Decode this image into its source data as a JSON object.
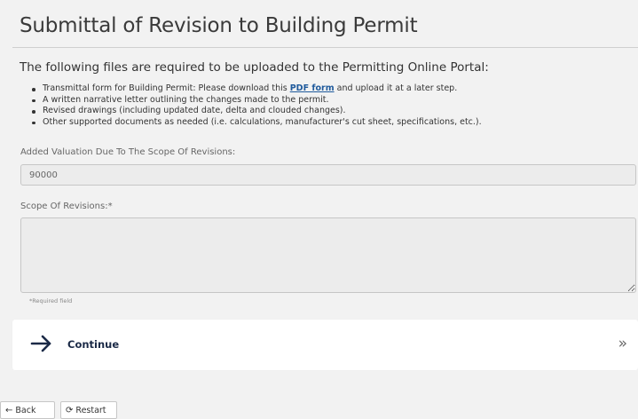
{
  "page": {
    "title": "Submittal of Revision to Building Permit",
    "intro_heading": "The following files are required to be uploaded to the Permitting Online Portal:"
  },
  "requirements": {
    "item1_prefix": "Transmittal form for Building Permit: Please download this ",
    "item1_link": "PDF form",
    "item1_suffix": " and upload it at a later step.",
    "item2": "A written narrative letter outlining the changes made to the permit.",
    "item3": "Revised drawings (including updated date, delta and clouded changes).",
    "item4": "Other supported documents as needed (i.e. calculations, manufacturer's cut sheet, specifications, etc.)."
  },
  "fields": {
    "valuation_label": "Added Valuation Due To The Scope Of Revisions:",
    "valuation_value": "90000",
    "scope_label": "Scope Of Revisions:*",
    "scope_value": "",
    "required_note": "*Required field"
  },
  "continue": {
    "label": "Continue",
    "arrow_icon": "arrow-right-icon",
    "chevrons": "»"
  },
  "footer": {
    "back_label": "Back",
    "back_icon": "←",
    "restart_label": "Restart",
    "restart_icon": "⟳"
  },
  "colors": {
    "link": "#1f5a9c",
    "continue_text": "#1b2a47",
    "background": "#f2f2f2"
  }
}
